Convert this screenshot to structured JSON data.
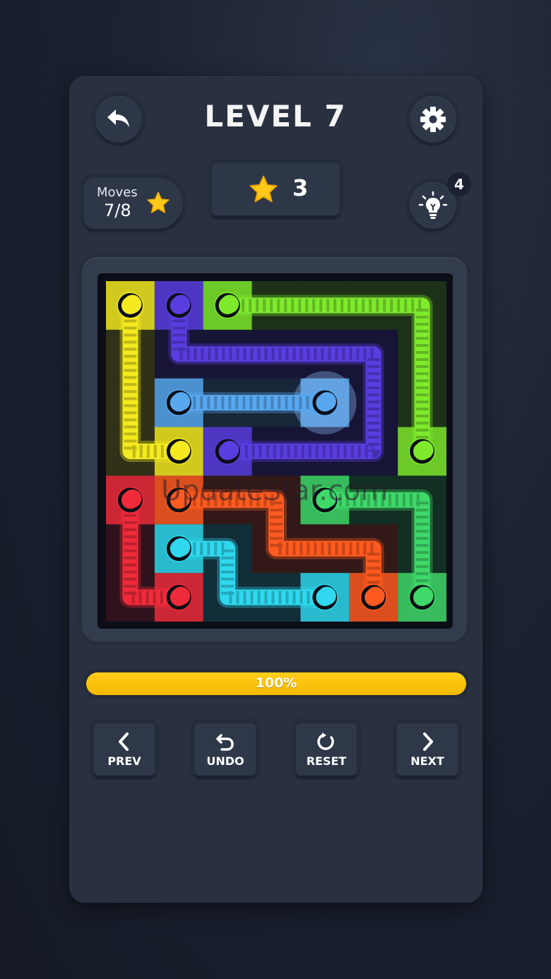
{
  "header": {
    "title": "LEVEL 7",
    "back_icon": "back-arrow-icon",
    "settings_icon": "gear-icon"
  },
  "stats": {
    "moves_label": "Moves",
    "moves_value": "7/8",
    "stars_count": "3",
    "hint_count": "4",
    "hint_icon": "lightbulb-icon"
  },
  "board": {
    "rows": 7,
    "cols": 7,
    "watermark": "UpdateStar.com",
    "flows": [
      {
        "color": "yellow",
        "hex": "#f4ea1f",
        "path": [
          [
            0,
            0
          ],
          [
            1,
            0
          ],
          [
            2,
            0
          ],
          [
            3,
            0
          ],
          [
            3,
            1
          ]
        ]
      },
      {
        "color": "blue",
        "hex": "#5a3de0",
        "path": [
          [
            0,
            1
          ],
          [
            1,
            1
          ],
          [
            1,
            2
          ],
          [
            1,
            3
          ],
          [
            1,
            4
          ],
          [
            1,
            5
          ],
          [
            2,
            5
          ],
          [
            3,
            5
          ],
          [
            3,
            4
          ],
          [
            3,
            3
          ],
          [
            3,
            2
          ]
        ]
      },
      {
        "color": "green",
        "hex": "#7eea2c",
        "path": [
          [
            0,
            2
          ],
          [
            0,
            3
          ],
          [
            0,
            4
          ],
          [
            0,
            5
          ],
          [
            0,
            6
          ],
          [
            1,
            6
          ],
          [
            2,
            6
          ],
          [
            3,
            6
          ]
        ]
      },
      {
        "color": "light-blue",
        "hex": "#58a8f0",
        "path": [
          [
            2,
            1
          ],
          [
            2,
            2
          ],
          [
            2,
            3
          ],
          [
            2,
            4
          ]
        ]
      },
      {
        "color": "red",
        "hex": "#ef2b3a",
        "path": [
          [
            4,
            0
          ],
          [
            5,
            0
          ],
          [
            6,
            0
          ],
          [
            6,
            1
          ]
        ]
      },
      {
        "color": "orange",
        "hex": "#ff5a1f",
        "path": [
          [
            4,
            1
          ],
          [
            4,
            2
          ],
          [
            4,
            3
          ],
          [
            5,
            3
          ],
          [
            5,
            4
          ],
          [
            5,
            5
          ],
          [
            6,
            5
          ]
        ]
      },
      {
        "color": "teal-green",
        "hex": "#3fd96a",
        "path": [
          [
            4,
            4
          ],
          [
            4,
            5
          ],
          [
            4,
            6
          ],
          [
            5,
            6
          ],
          [
            6,
            6
          ]
        ]
      },
      {
        "color": "cyan",
        "hex": "#2fd8ee",
        "path": [
          [
            5,
            1
          ],
          [
            5,
            2
          ],
          [
            6,
            2
          ],
          [
            6,
            3
          ],
          [
            6,
            4
          ]
        ]
      }
    ],
    "selected_cell": [
      2,
      4
    ]
  },
  "progress": {
    "value": 1.0,
    "label": "100%"
  },
  "controls": {
    "prev_label": "PREV",
    "undo_label": "UNDO",
    "reset_label": "RESET",
    "next_label": "NEXT"
  },
  "colors": {
    "panel": "#293141",
    "progress": "#f6b800",
    "star": "#ffc81a"
  }
}
